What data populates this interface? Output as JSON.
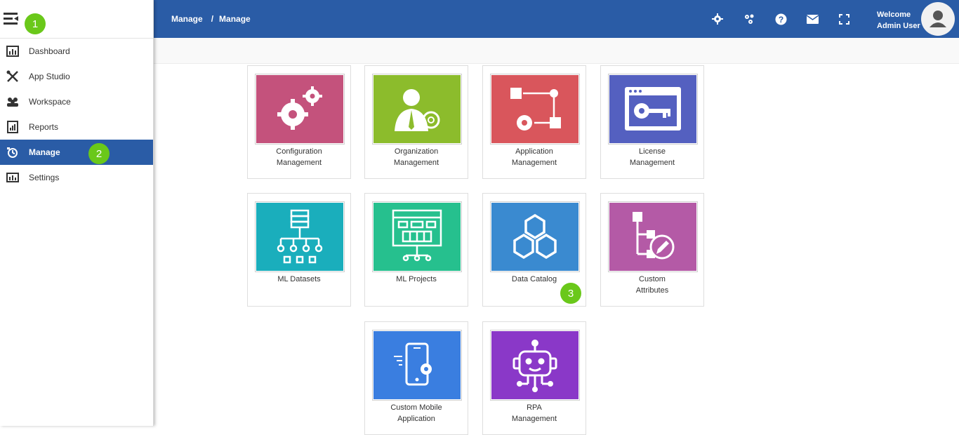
{
  "sidebar": {
    "items": [
      {
        "label": "Dashboard",
        "icon": "dashboard-icon"
      },
      {
        "label": "App Studio",
        "icon": "tools-icon"
      },
      {
        "label": "Workspace",
        "icon": "workspace-icon"
      },
      {
        "label": "Reports",
        "icon": "reports-icon"
      },
      {
        "label": "Manage",
        "icon": "manage-icon",
        "active": true
      },
      {
        "label": "Settings",
        "icon": "settings-chart-icon"
      }
    ]
  },
  "header": {
    "breadcrumb": [
      "Manage",
      "/",
      "Manage"
    ],
    "welcome_line1": "Welcome",
    "welcome_line2": "Admin User",
    "icons": [
      "gear-icon",
      "network-gears-icon",
      "help-icon",
      "mail-icon",
      "fullscreen-icon"
    ]
  },
  "badges": [
    "1",
    "2",
    "3"
  ],
  "tiles": [
    {
      "label": "Configuration\nManagement",
      "color": "#c4527c"
    },
    {
      "label": "Organization\nManagement",
      "color": "#8cbc2c"
    },
    {
      "label": "Application\nManagement",
      "color": "#d9565c"
    },
    {
      "label": "License\nManagement",
      "color": "#5460c0"
    },
    {
      "label": "ML Datasets",
      "color": "#1aaebc"
    },
    {
      "label": "ML Projects",
      "color": "#26c08e"
    },
    {
      "label": "Data Catalog",
      "color": "#3a8ad0"
    },
    {
      "label": "Custom\nAttributes",
      "color": "#b45aa6"
    },
    {
      "label": "Custom Mobile\nApplication",
      "color": "#3a7ee0"
    },
    {
      "label": "RPA\nManagement",
      "color": "#8a38c8"
    }
  ],
  "colors": {
    "header": "#2a5ca6",
    "badge": "#6ac81a"
  }
}
